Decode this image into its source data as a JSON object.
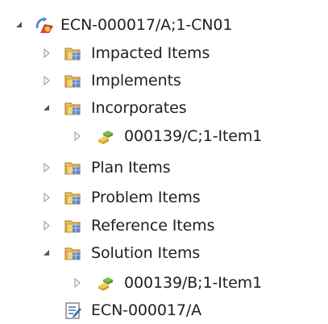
{
  "tree": {
    "root": {
      "label": "ECN-000017/A;1-CN01",
      "icon": "change-notice-icon",
      "expanded": true
    },
    "children": [
      {
        "label": "Impacted Items",
        "icon": "folder-icon",
        "expanded": false
      },
      {
        "label": "Implements",
        "icon": "folder-icon",
        "expanded": false
      },
      {
        "label": "Incorporates",
        "icon": "folder-icon",
        "expanded": true
      },
      {
        "label": "000139/C;1-Item1",
        "icon": "item-revision-icon",
        "expanded": false
      },
      {
        "label": "Plan Items",
        "icon": "folder-icon",
        "expanded": false
      },
      {
        "label": "Problem Items",
        "icon": "folder-icon",
        "expanded": false
      },
      {
        "label": "Reference Items",
        "icon": "folder-icon",
        "expanded": false
      },
      {
        "label": "Solution Items",
        "icon": "folder-icon",
        "expanded": true
      },
      {
        "label": "000139/B;1-Item1",
        "icon": "item-revision-icon",
        "expanded": false
      },
      {
        "label": "ECN-000017/A",
        "icon": "form-icon",
        "expanded": false
      }
    ]
  },
  "colors": {
    "arrow_collapsed": "#a3a3a3",
    "arrow_expanded": "#555555",
    "folder_body": "#f0c25e",
    "folder_stroke": "#a77c22",
    "item_yellow": "#f2d24c",
    "item_green": "#7fbd48",
    "root_red": "#d84a3a",
    "root_blue": "#4c7fd0",
    "form_blue": "#3f6db5"
  }
}
